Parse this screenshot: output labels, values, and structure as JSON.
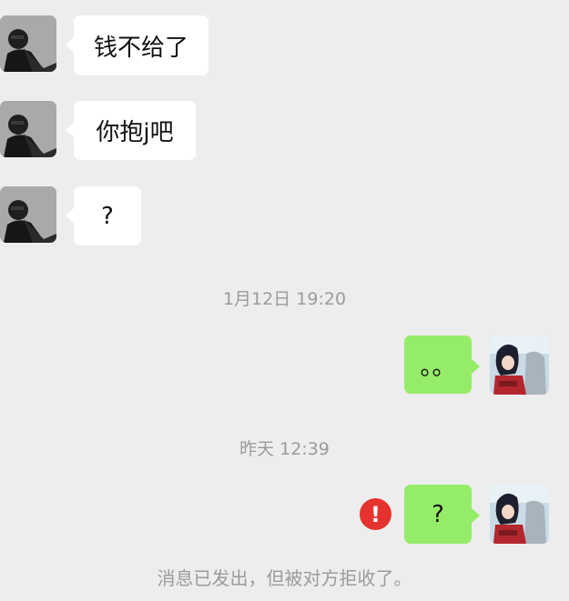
{
  "messages": [
    {
      "from": "other",
      "text": "钱不给了"
    },
    {
      "from": "other",
      "text": "你抱j吧"
    },
    {
      "from": "other",
      "text": "?"
    },
    {
      "from": "me",
      "text": "。。"
    },
    {
      "from": "me",
      "text": "?",
      "status": "rejected"
    }
  ],
  "timestamps": [
    "1月12日 19:20",
    "昨天 12:39"
  ],
  "system_notice": "消息已发出，但被对方拒收了。",
  "error_icon_glyph": "!",
  "colors": {
    "background": "#ededed",
    "other_bubble": "#ffffff",
    "my_bubble": "#95ec69",
    "error_red": "#e6322e",
    "timestamp_text": "#9b9b9b"
  }
}
